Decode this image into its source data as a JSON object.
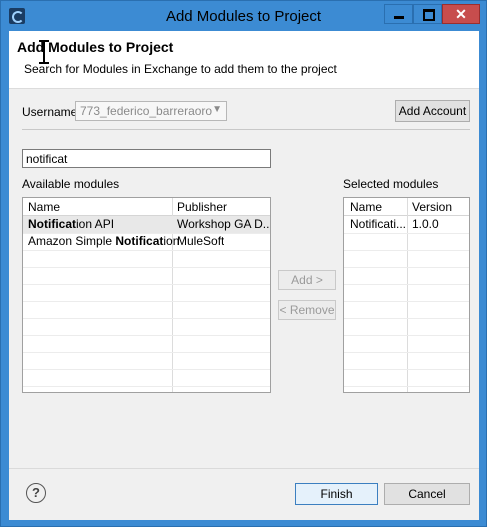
{
  "window": {
    "title": "Add Modules to Project"
  },
  "header": {
    "title": "Add Modules to Project",
    "subtitle": "Search for Modules in Exchange to add them to the project"
  },
  "account": {
    "username_label": "Username",
    "username_value": "773_federico_barreraoro",
    "add_account_label": "Add Account"
  },
  "search": {
    "value": "notificat"
  },
  "available": {
    "label": "Available modules",
    "columns": [
      "Name",
      "Publisher"
    ],
    "rows": [
      {
        "name_bold": "Notificat",
        "name_rest": "ion API",
        "publisher": "Workshop GA D..."
      },
      {
        "name_prefix": "Amazon Simple ",
        "name_bold": "Notificat",
        "name_rest": "ion",
        "publisher": "MuleSoft"
      }
    ]
  },
  "selected": {
    "label": "Selected modules",
    "columns": [
      "Name",
      "Version"
    ],
    "rows": [
      {
        "name": "Notificati...",
        "version": "1.0.0"
      }
    ]
  },
  "actions": {
    "add_label": "Add >",
    "remove_label": "< Remove"
  },
  "footer": {
    "help_glyph": "?",
    "finish_label": "Finish",
    "cancel_label": "Cancel"
  },
  "colors": {
    "titlebar": "#3c8bd3",
    "close": "#c74d4d"
  }
}
